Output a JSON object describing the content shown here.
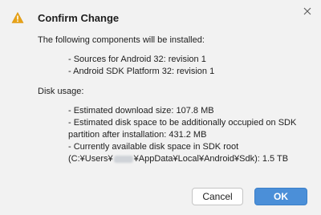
{
  "dialog": {
    "title": "Confirm Change",
    "close_icon": "close-icon",
    "warning_icon": "warning-icon",
    "warning_color": "#e8a317"
  },
  "content": {
    "intro": "The following components will be installed:",
    "components": [
      "- Sources for Android 32: revision 1",
      "- Android SDK Platform 32: revision 1"
    ],
    "disk_heading": "Disk usage:",
    "disk_download": "- Estimated download size: 107.8 MB",
    "disk_space_line1": "- Estimated disk space to be additionally occupied on SDK",
    "disk_space_line2": "partition after installation: 431.2 MB",
    "disk_available_line1": "- Currently available disk space in SDK root",
    "disk_available_prefix": "(C:¥Users¥",
    "disk_available_suffix": "¥AppData¥Local¥Android¥Sdk): 1.5 TB"
  },
  "buttons": {
    "cancel": "Cancel",
    "ok": "OK",
    "ok_color": "#4b8fd8"
  }
}
